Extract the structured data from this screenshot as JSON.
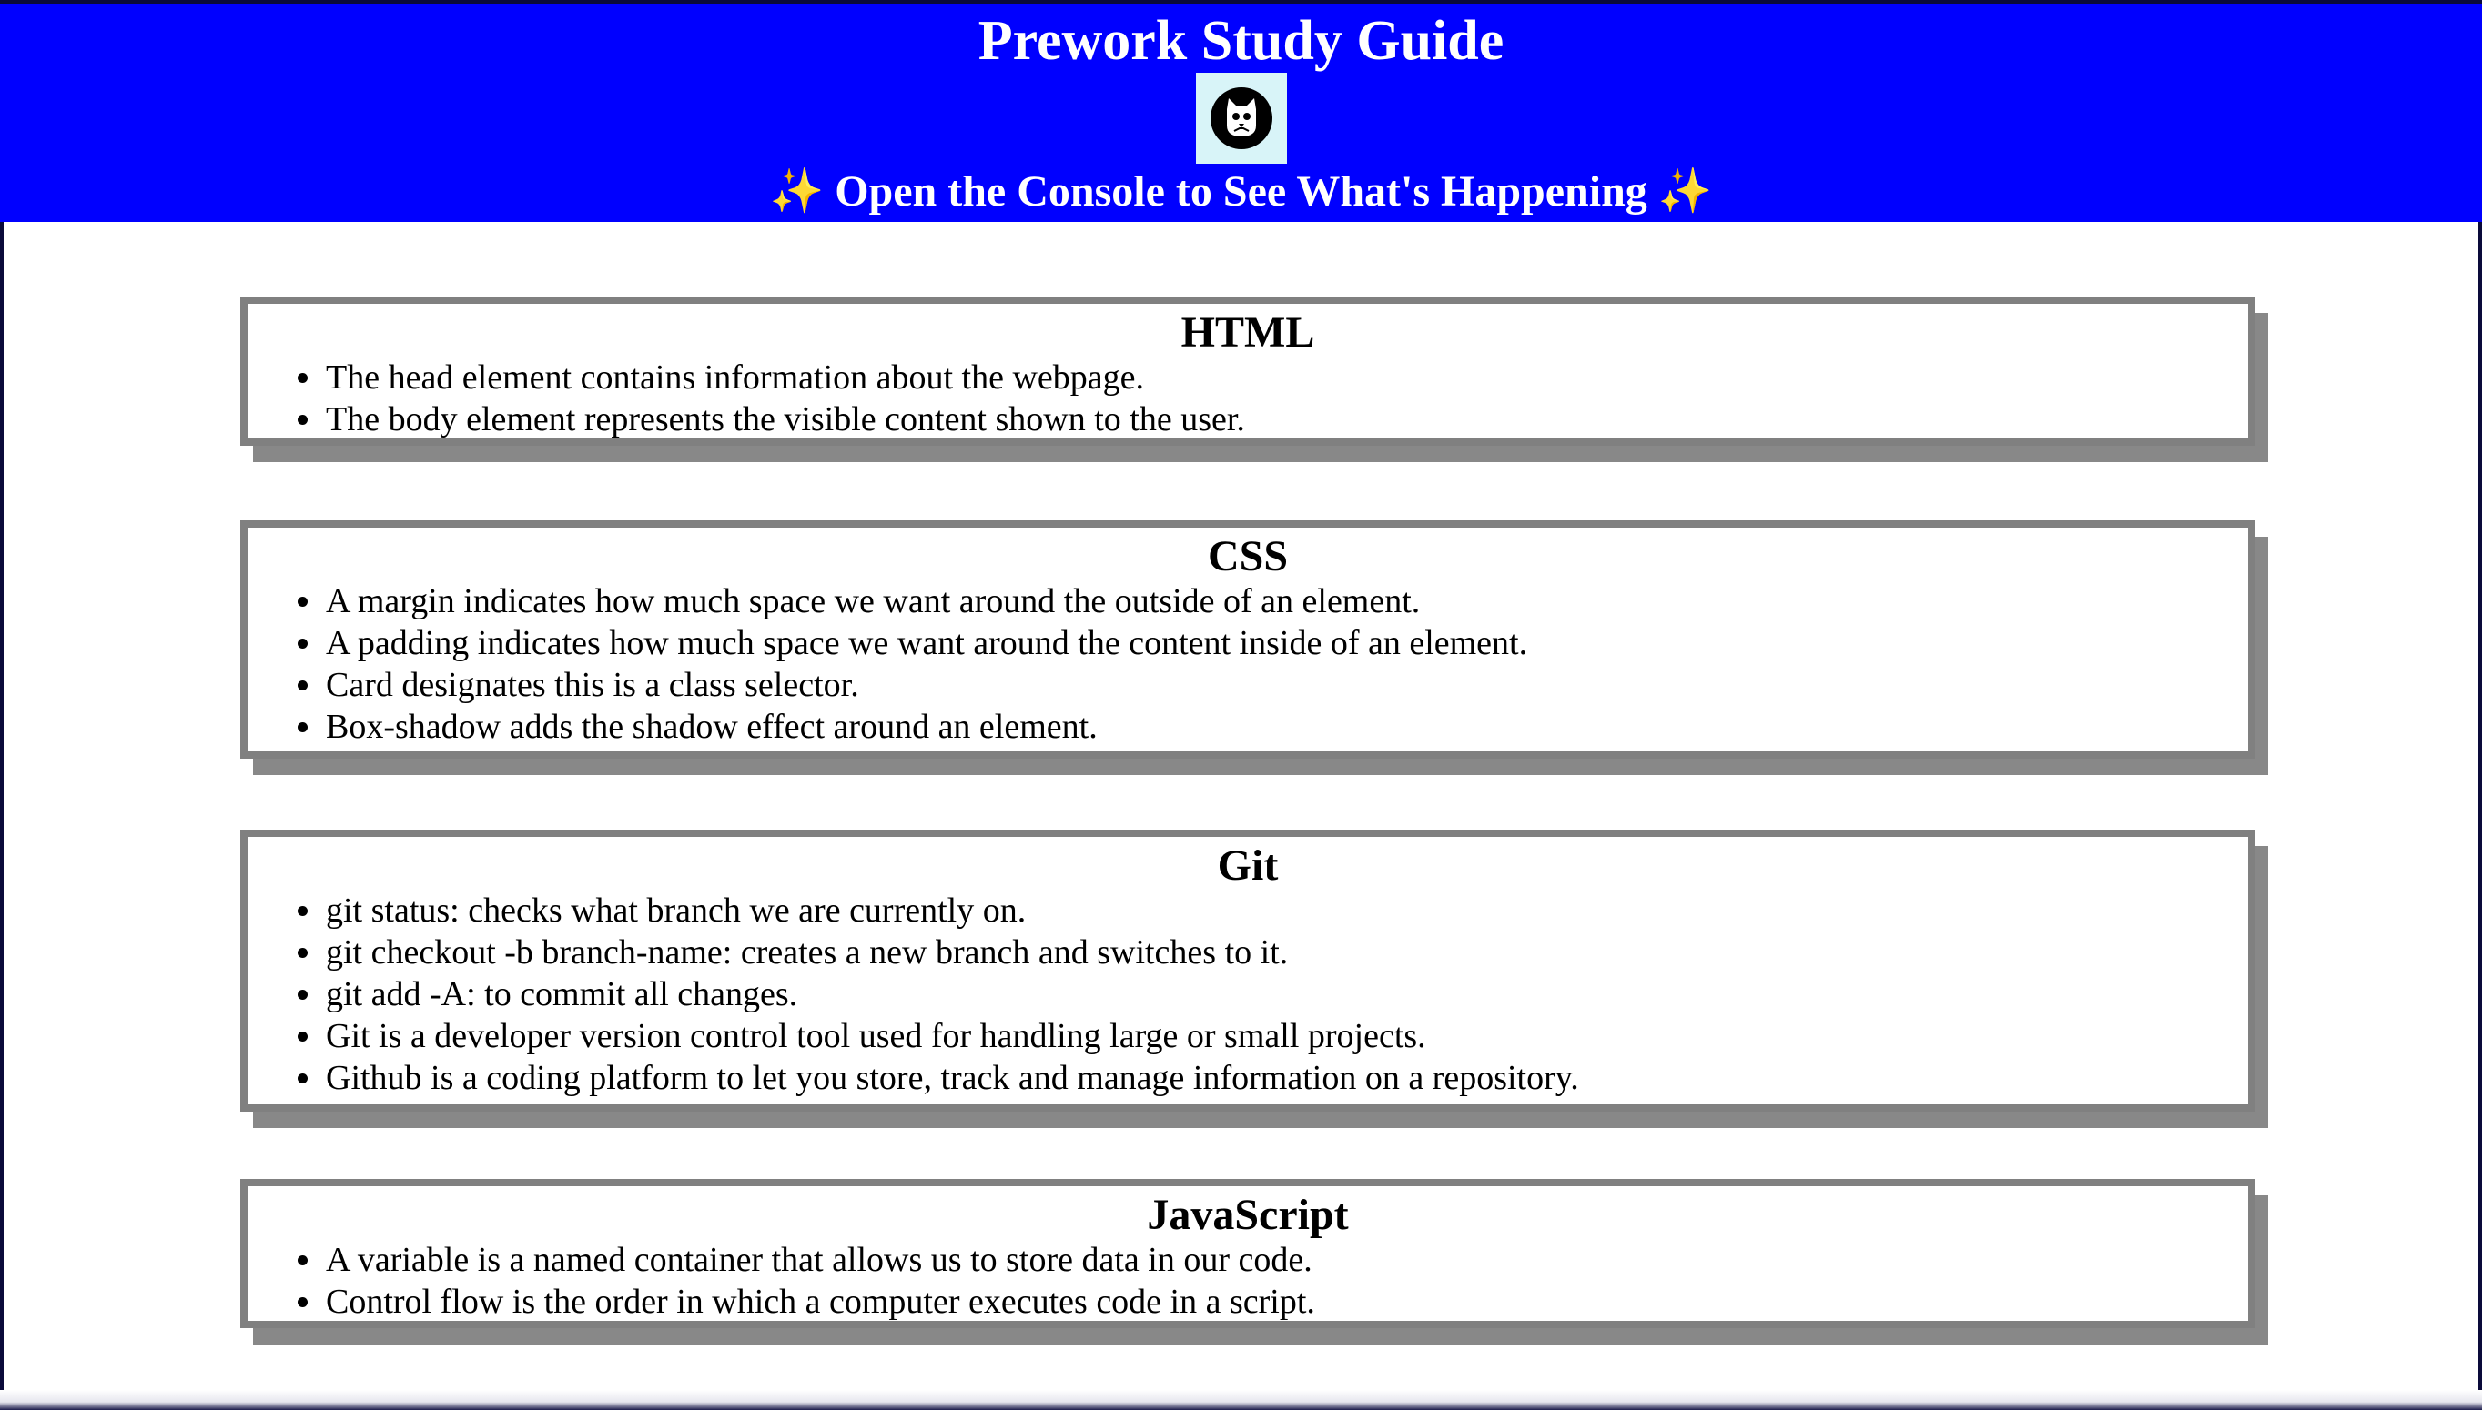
{
  "header": {
    "title": "Prework Study Guide",
    "subtitle_sparkle_left": "✨",
    "subtitle": "Open the Console to See What's Happening",
    "subtitle_sparkle_right": "✨",
    "logo_icon": "cat-logo-icon",
    "background_color": "#0000ff"
  },
  "cards": [
    {
      "title": "HTML",
      "items": [
        "The head element contains information about the webpage.",
        "The body element represents the visible content shown to the user."
      ]
    },
    {
      "title": "CSS",
      "items": [
        "A margin indicates how much space we want around the outside of an element.",
        "A padding indicates how much space we want around the content inside of an element.",
        "Card designates this is a class selector.",
        "Box-shadow adds the shadow effect around an element."
      ]
    },
    {
      "title": "Git",
      "items": [
        "git status: checks what branch we are currently on.",
        "git checkout -b branch-name: creates a new branch and switches to it.",
        "git add -A: to commit all changes.",
        "Git is a developer version control tool used for handling large or small projects.",
        "Github is a coding platform to let you store, track and manage information on a repository."
      ]
    },
    {
      "title": "JavaScript",
      "items": [
        "A variable is a named container that allows us to store data in our code.",
        "Control flow is the order in which a computer executes code in a script."
      ]
    }
  ]
}
